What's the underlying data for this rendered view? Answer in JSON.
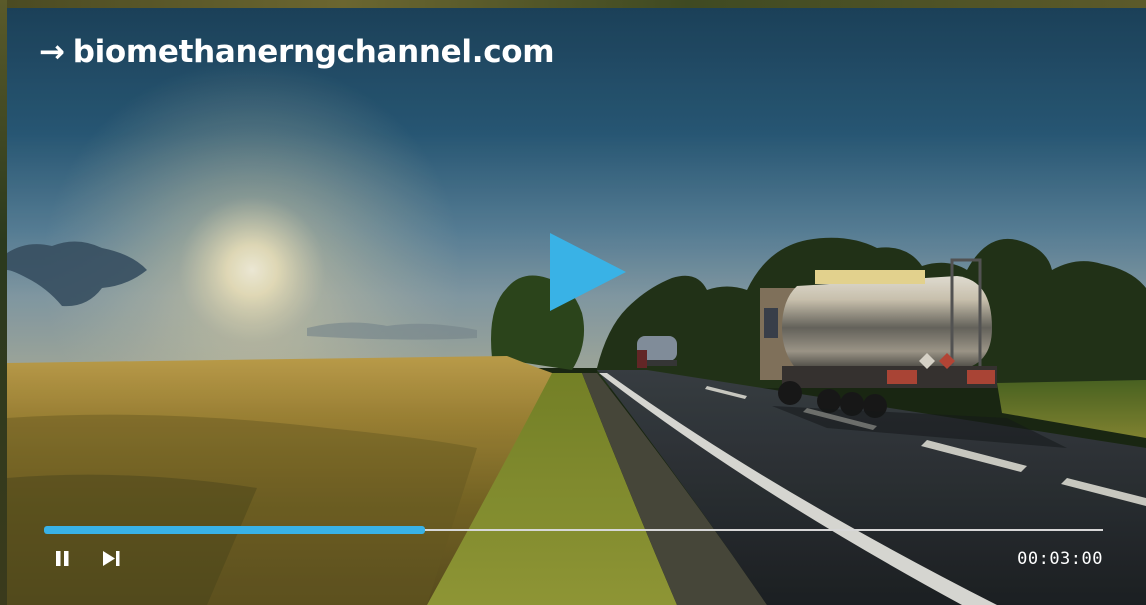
{
  "player": {
    "link_text": "biomethanerngchannel.com",
    "link_arrow": "→",
    "time_display": "00:03:00",
    "progress_fraction": 0.36,
    "accent_color": "#39b2e6"
  },
  "controls": {
    "pause_icon": "pause-icon",
    "next_icon": "skip-next-icon",
    "play_icon": "play-icon"
  }
}
